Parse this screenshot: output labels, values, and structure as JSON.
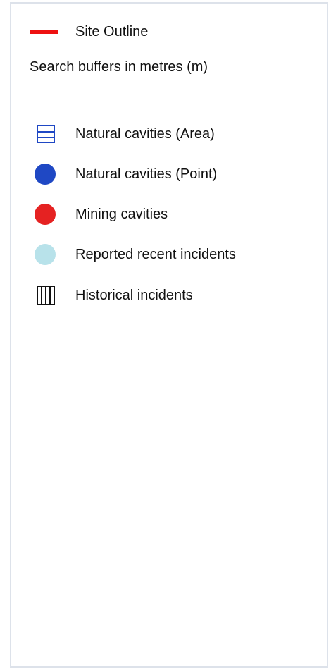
{
  "legend": {
    "site_outline": {
      "label": "Site Outline",
      "color": "#ee1111"
    },
    "buffers_heading": "Search buffers in metres (m)",
    "items": [
      {
        "label": "Natural cavities (Area)",
        "symbol": "blue-hatched-square",
        "color": "#1f48c4"
      },
      {
        "label": "Natural cavities (Point)",
        "symbol": "blue-circle",
        "color": "#1f48c4"
      },
      {
        "label": "Mining cavities",
        "symbol": "red-circle",
        "color": "#e52222"
      },
      {
        "label": "Reported recent incidents",
        "symbol": "light-blue-circle",
        "color": "#b8e2ea"
      },
      {
        "label": "Historical incidents",
        "symbol": "black-vertical-hatch",
        "color": "#111111"
      }
    ]
  }
}
